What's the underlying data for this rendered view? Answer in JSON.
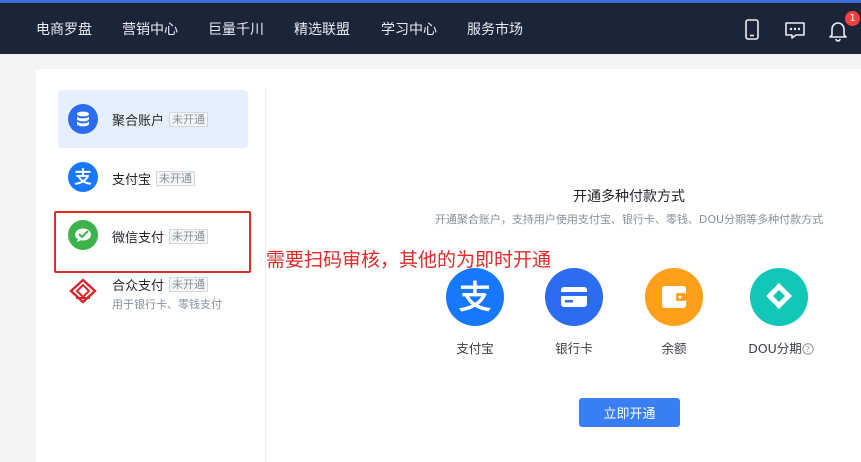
{
  "nav": {
    "items": [
      "电商罗盘",
      "营销中心",
      "巨量千川",
      "精选联盟",
      "学习中心",
      "服务市场"
    ],
    "notification_count": "1",
    "icons": [
      "mobile-icon",
      "message-icon",
      "bell-icon"
    ]
  },
  "payments": {
    "items": [
      {
        "label": "聚合账户",
        "tag": "未开通"
      },
      {
        "label": "支付宝",
        "tag": "未开通"
      },
      {
        "label": "微信支付",
        "tag": "未开通"
      },
      {
        "label": "合众支付",
        "tag": "未开通",
        "note": "用于银行卡、零钱支付"
      }
    ]
  },
  "annotation": "需要扫码审核，其他的为即时开通",
  "main": {
    "title": "开通多种付款方式",
    "subtitle": "开通聚合账户，支持用户使用支付宝、银行卡、零钱、DOU分期等多种付款方式",
    "methods": [
      {
        "label": "支付宝",
        "color": "#1677ff"
      },
      {
        "label": "银行卡",
        "color": "#2b6cf0"
      },
      {
        "label": "余额",
        "color": "#ff9f1a"
      },
      {
        "label": "DOU分期",
        "color": "#12c6b8"
      }
    ],
    "open_button": "立即开通"
  },
  "colors": {
    "nav_bg": "#1c2538",
    "accent": "#3a7ef5",
    "annotation": "#e02a2a"
  }
}
